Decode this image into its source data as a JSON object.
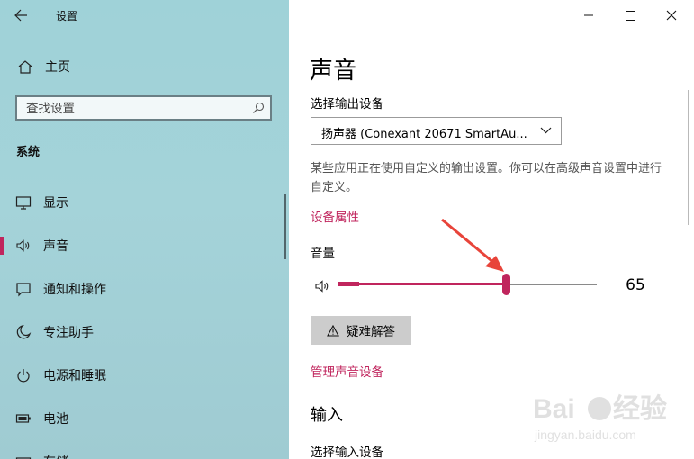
{
  "window": {
    "title": "设置",
    "minimize_icon": "minimize-icon",
    "maximize_icon": "maximize-icon",
    "close_icon": "close-icon"
  },
  "sidebar": {
    "home_label": "主页",
    "search_placeholder": "查找设置",
    "section_label": "系统",
    "items": [
      {
        "label": "显示",
        "icon": "monitor-icon"
      },
      {
        "label": "声音",
        "icon": "speaker-icon",
        "active": true
      },
      {
        "label": "通知和操作",
        "icon": "message-icon"
      },
      {
        "label": "专注助手",
        "icon": "moon-icon"
      },
      {
        "label": "电源和睡眠",
        "icon": "power-icon"
      },
      {
        "label": "电池",
        "icon": "battery-icon"
      },
      {
        "label": "存储",
        "icon": "storage-icon"
      }
    ]
  },
  "main": {
    "title": "声音",
    "output_label": "选择输出设备",
    "output_device": "扬声器 (Conexant 20671 SmartAu...",
    "info_text": "某些应用正在使用自定义的输出设置。你可以在高级声音设置中进行自定义。",
    "device_properties_link": "设备属性",
    "volume_label": "音量",
    "volume_value": "65",
    "volume_fraction": 0.65,
    "troubleshoot_label": "疑难解答",
    "manage_devices_link": "管理声音设备",
    "input_heading": "输入",
    "input_label": "选择输入设备"
  },
  "colors": {
    "accent": "#c0255d",
    "sidebar_bg": "#a1d1d7",
    "annotation_arrow": "#e8443a"
  },
  "watermark": {
    "brand": "Baidu经验",
    "url": "jingyan.baidu.com"
  }
}
